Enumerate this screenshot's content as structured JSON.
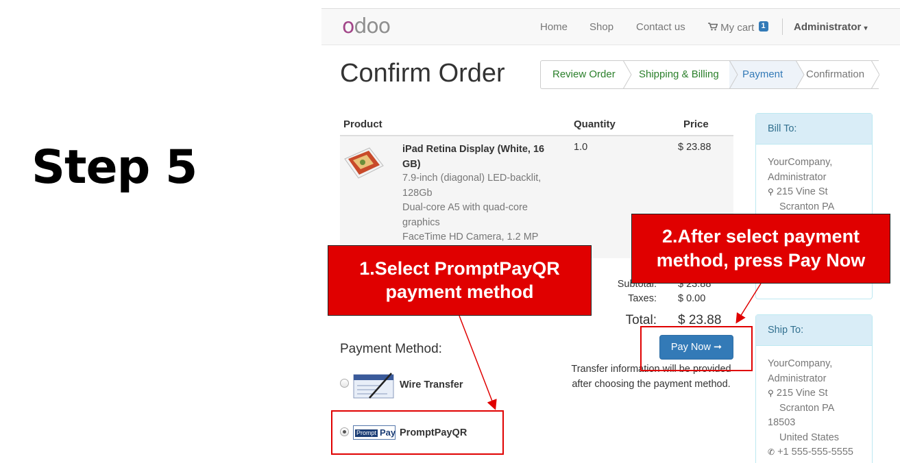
{
  "slide": {
    "step_title": "Step 5"
  },
  "navbar": {
    "logo": "odoo",
    "home": "Home",
    "shop": "Shop",
    "contact": "Contact us",
    "cart_label": "My cart",
    "cart_count": "1",
    "user": "Administrator"
  },
  "page": {
    "title": "Confirm Order"
  },
  "wizard": {
    "steps": [
      "Review Order",
      "Shipping & Billing",
      "Payment",
      "Confirmation"
    ],
    "active": "Payment"
  },
  "order_table": {
    "headers": [
      "Product",
      "Quantity",
      "Price"
    ],
    "rows": [
      {
        "name": "iPad Retina Display (White, 16 GB)",
        "description": "7.9-inch (diagonal) LED-backlit, 128Gb\nDual-core A5 with quad-core graphics\nFaceTime HD Camera, 1.2 MP",
        "quantity": "1.0",
        "price": "$ 23.88"
      }
    ]
  },
  "totals": {
    "subtotal_label": "Subtotal:",
    "subtotal": "$ 23.88",
    "taxes_label": "Taxes:",
    "taxes": "$ 0.00",
    "total_label": "Total:",
    "total": "$ 23.88"
  },
  "payment": {
    "label": "Payment Method:",
    "methods": [
      {
        "name": "Wire Transfer",
        "selected": false
      },
      {
        "name": "PromptPayQR",
        "selected": true
      }
    ],
    "pay_button": "Pay Now",
    "note": "Transfer information will be provided after choosing the payment method."
  },
  "bill_to": {
    "title": "Bill To:",
    "name": "YourCompany,",
    "contact": "Administrator",
    "street": "215 Vine St",
    "city": "Scranton PA"
  },
  "ship_to": {
    "title": "Ship To:",
    "name": "YourCompany,",
    "contact": "Administrator",
    "street": "215 Vine St",
    "city": "Scranton PA",
    "zip": "18503",
    "country": "United States",
    "phone": "+1 555-555-5555"
  },
  "annotations": {
    "callout1": "1.Select PromptPayQR payment method",
    "callout2": "2.After select payment method, press Pay Now",
    "color": "#e00000"
  },
  "colors": {
    "primary": "#337ab7",
    "completed_step": "#2a7f2a",
    "panel_header": "#d9edf7",
    "logo_accent": "#a24689"
  }
}
